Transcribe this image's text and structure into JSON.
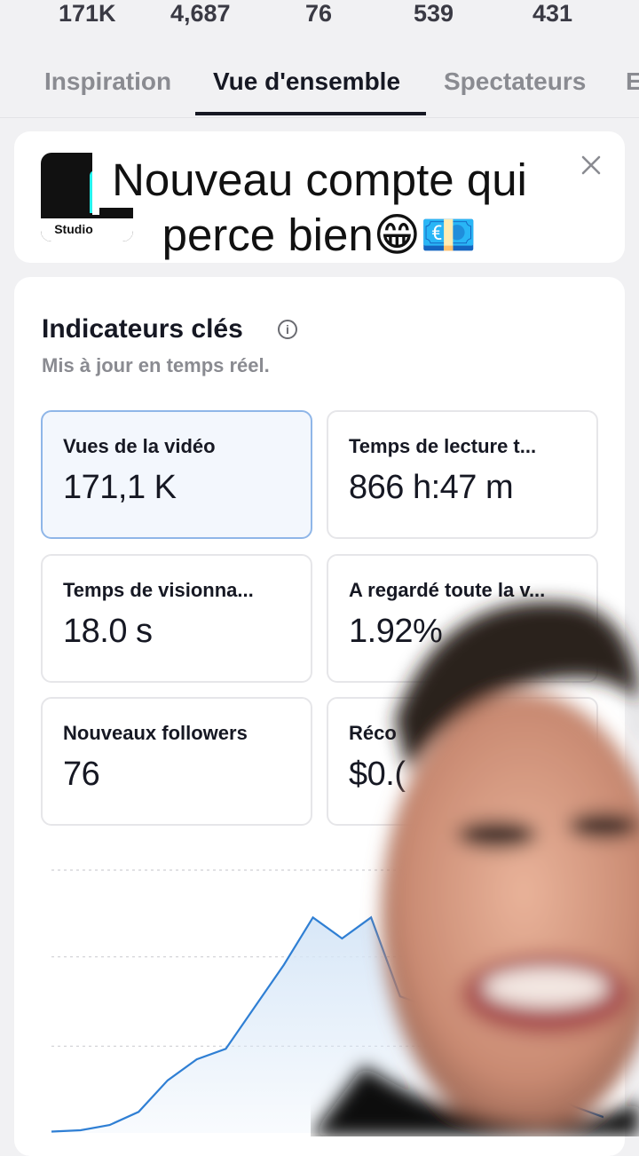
{
  "stats": [
    "171K",
    "4,687",
    "76",
    "539",
    "431"
  ],
  "tabs": [
    "Inspiration",
    "Vue d'ensemble",
    "Spectateurs",
    "E"
  ],
  "active_tab": "Vue d'ensemble",
  "app_logo": {
    "label": "Studio"
  },
  "caption": {
    "line1": "Nouveau compte qui",
    "line2": "perce bien😁💶"
  },
  "key_metrics": {
    "title": "Indicateurs clés",
    "subtitle": "Mis à jour en temps réel.",
    "items": [
      {
        "label": "Vues de la vidéo",
        "value": "171,1 K"
      },
      {
        "label": "Temps de lecture t...",
        "value": "866 h:47 m"
      },
      {
        "label": "Temps de visionna...",
        "value": "18.0 s"
      },
      {
        "label": "A regardé toute la v...",
        "value": "1.92%"
      },
      {
        "label": "Nouveaux followers",
        "value": "76"
      },
      {
        "label": "Réco",
        "value": "$0.("
      }
    ]
  },
  "colors": {
    "accent_line": "#2f7fd4",
    "fill": "#d6e6f7"
  },
  "chart_data": {
    "type": "area",
    "y": [
      0.5,
      1,
      3,
      8,
      20,
      28,
      32,
      48,
      64,
      82,
      74,
      82,
      52,
      48,
      40,
      32,
      22,
      16,
      10,
      6
    ],
    "ylim": [
      0,
      100
    ],
    "grid": true
  }
}
